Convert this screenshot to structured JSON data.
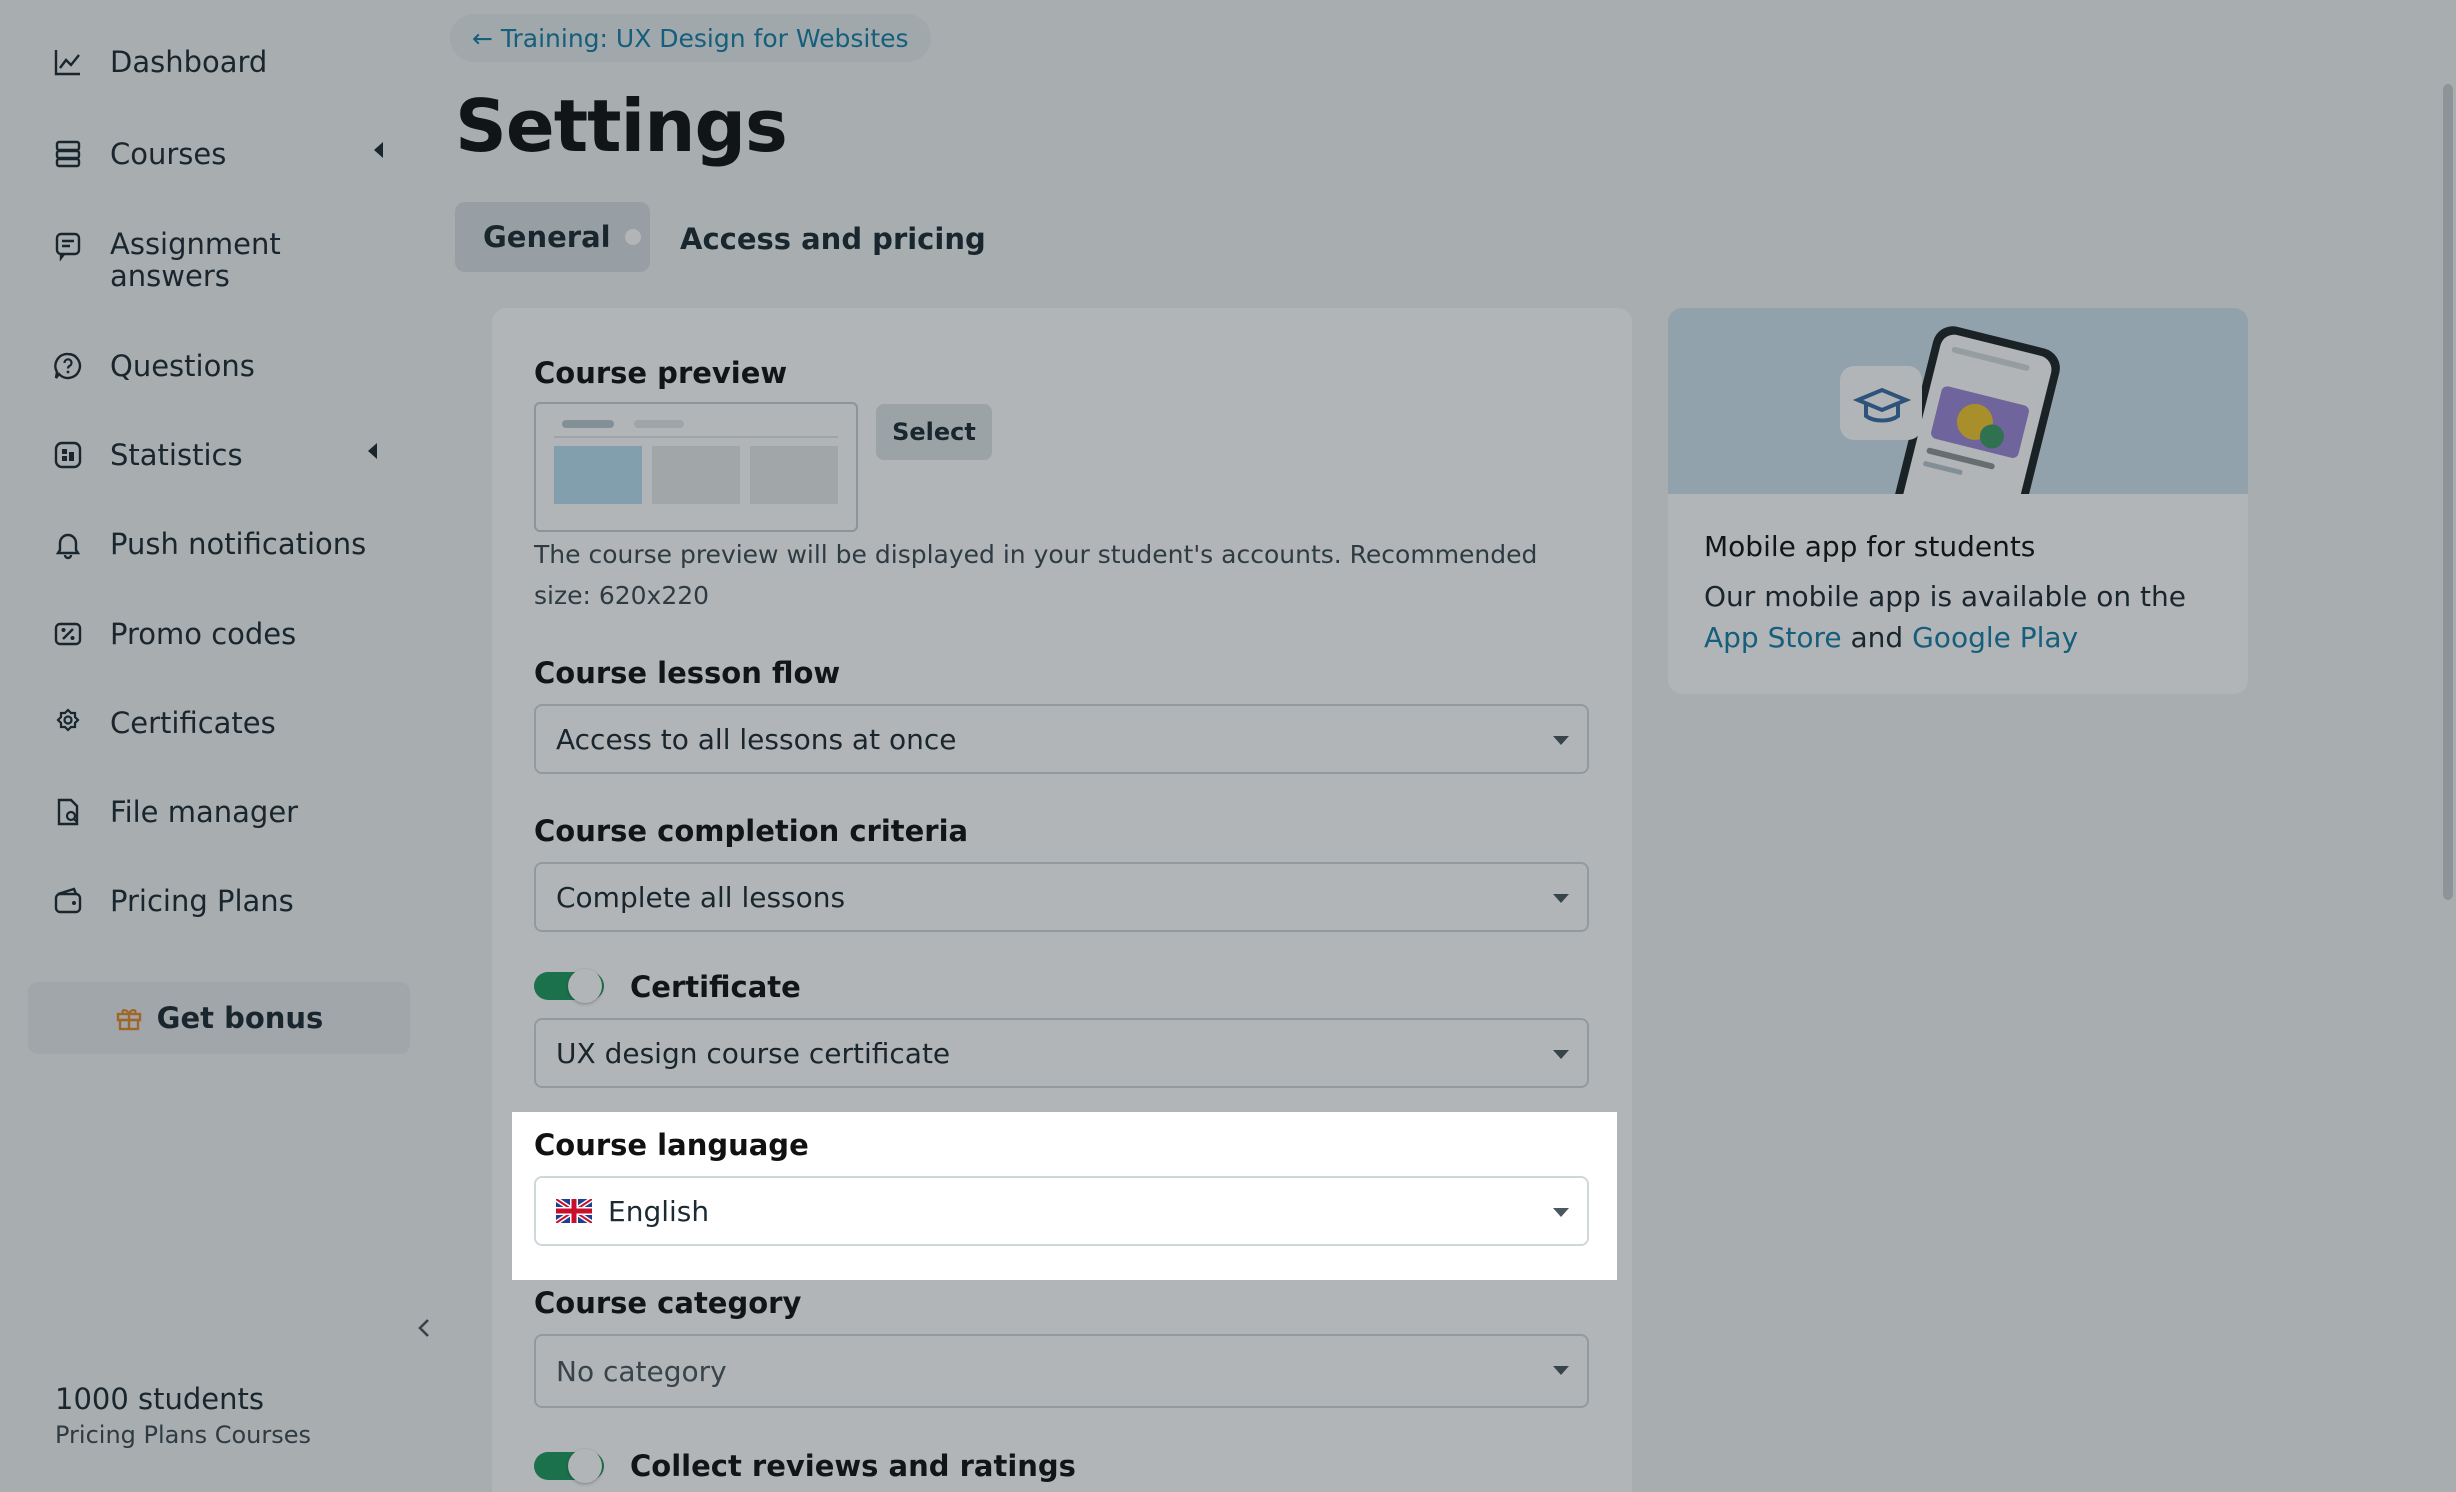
{
  "sidebar": {
    "items": [
      {
        "label": "Dashboard",
        "icon": "chart-line-icon"
      },
      {
        "label": "Courses",
        "icon": "stack-icon"
      },
      {
        "label": "Assignment",
        "label2": "answers",
        "icon": "assignment-icon"
      },
      {
        "label": "Questions",
        "icon": "question-icon"
      },
      {
        "label": "Statistics",
        "icon": "statistics-icon"
      },
      {
        "label": "Push notifications",
        "icon": "bell-icon"
      },
      {
        "label": "Promo codes",
        "icon": "promo-icon"
      },
      {
        "label": "Certificates",
        "icon": "certificate-icon"
      },
      {
        "label": "File manager",
        "icon": "file-icon"
      },
      {
        "label": "Pricing Plans",
        "icon": "wallet-icon"
      }
    ],
    "bonus_label": "Get bonus",
    "footer": {
      "count": "1000 students",
      "plan": "Pricing Plans Courses"
    }
  },
  "header": {
    "back_link": "← Training: UX Design for Websites",
    "title": "Settings",
    "tabs": [
      {
        "label": "General"
      },
      {
        "label": "Access and pricing"
      }
    ]
  },
  "form": {
    "preview": {
      "title": "Course preview",
      "select_label": "Select",
      "hint": "The course preview will be displayed in your student's accounts. Recommended size: 620x220"
    },
    "lesson_flow": {
      "title": "Course lesson flow",
      "value": "Access to all lessons at once"
    },
    "completion": {
      "title": "Course completion criteria",
      "value": "Complete all lessons"
    },
    "certificate": {
      "title": "Certificate",
      "enabled": true,
      "value": "UX design course certificate"
    },
    "language": {
      "title": "Course language",
      "value": "English"
    },
    "category": {
      "title": "Course category",
      "value": "No category"
    },
    "reviews": {
      "title": "Collect reviews and ratings",
      "enabled": true
    }
  },
  "promo": {
    "title": "Mobile app for students",
    "text": "Our mobile app is available on the",
    "link1": "App Store",
    "and": "and",
    "link2": "Google Play"
  },
  "colors": {
    "accent": "#167ea8",
    "toggle_on": "#1f9a5e",
    "overlay": "rgba(20,30,35,0.33)"
  }
}
